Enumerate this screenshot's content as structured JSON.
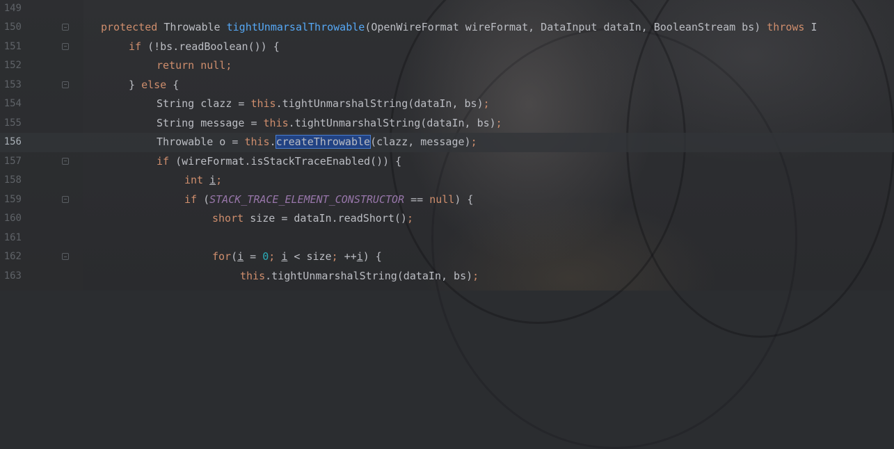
{
  "editor": {
    "current_line": "156",
    "lines": [
      {
        "num": "149",
        "tokens": []
      },
      {
        "num": "150",
        "tokens": [
          {
            "t": "protected ",
            "c": "kw"
          },
          {
            "t": "Throwable ",
            "c": "d"
          },
          {
            "t": "tightUnmarsalThrowable",
            "c": "fn"
          },
          {
            "t": "(OpenWireFormat wireFormat, DataInput dataIn, BooleanStream bs) ",
            "c": "d"
          },
          {
            "t": "throws ",
            "c": "kw"
          },
          {
            "t": "I",
            "c": "d"
          }
        ]
      },
      {
        "num": "151",
        "tokens": [
          {
            "t": "if ",
            "c": "kw"
          },
          {
            "t": "(!bs.readBoolean()) {",
            "c": "d"
          }
        ]
      },
      {
        "num": "152",
        "tokens": [
          {
            "t": "return null",
            "c": "kw"
          },
          {
            "t": ";",
            "c": "kw"
          }
        ]
      },
      {
        "num": "153",
        "tokens": [
          {
            "t": "} ",
            "c": "d"
          },
          {
            "t": "else ",
            "c": "kw"
          },
          {
            "t": "{",
            "c": "d"
          }
        ]
      },
      {
        "num": "154",
        "tokens": [
          {
            "t": "String clazz = ",
            "c": "d"
          },
          {
            "t": "this",
            "c": "kw"
          },
          {
            "t": ".tightUnmarshalString(dataIn, bs)",
            "c": "d"
          },
          {
            "t": ";",
            "c": "kw"
          }
        ]
      },
      {
        "num": "155",
        "tokens": [
          {
            "t": "String message = ",
            "c": "d"
          },
          {
            "t": "this",
            "c": "kw"
          },
          {
            "t": ".tightUnmarshalString(dataIn, bs)",
            "c": "d"
          },
          {
            "t": ";",
            "c": "kw"
          }
        ]
      },
      {
        "num": "156",
        "tokens": [
          {
            "t": "Throwable o = ",
            "c": "d"
          },
          {
            "t": "this",
            "c": "kw"
          },
          {
            "t": ".",
            "c": "d"
          },
          {
            "t": "createThrowable",
            "c": "sel"
          },
          {
            "t": "(clazz, message)",
            "c": "d"
          },
          {
            "t": ";",
            "c": "kw"
          }
        ]
      },
      {
        "num": "157",
        "tokens": [
          {
            "t": "if ",
            "c": "kw"
          },
          {
            "t": "(wireFormat.isStackTraceEnabled()) {",
            "c": "d"
          }
        ]
      },
      {
        "num": "158",
        "tokens": [
          {
            "t": "int ",
            "c": "kw"
          },
          {
            "t": "i",
            "c": "var"
          },
          {
            "t": ";",
            "c": "kw"
          }
        ]
      },
      {
        "num": "159",
        "tokens": [
          {
            "t": "if ",
            "c": "kw"
          },
          {
            "t": "(",
            "c": "d"
          },
          {
            "t": "STACK_TRACE_ELEMENT_CONSTRUCTOR",
            "c": "const"
          },
          {
            "t": " == ",
            "c": "d"
          },
          {
            "t": "null",
            "c": "kw"
          },
          {
            "t": ") {",
            "c": "d"
          }
        ]
      },
      {
        "num": "160",
        "tokens": [
          {
            "t": "short ",
            "c": "kw"
          },
          {
            "t": "size = dataIn.readShort()",
            "c": "d"
          },
          {
            "t": ";",
            "c": "kw"
          }
        ]
      },
      {
        "num": "161",
        "tokens": []
      },
      {
        "num": "162",
        "tokens": [
          {
            "t": "for",
            "c": "kw"
          },
          {
            "t": "(",
            "c": "d"
          },
          {
            "t": "i",
            "c": "var"
          },
          {
            "t": " = ",
            "c": "d"
          },
          {
            "t": "0",
            "c": "num"
          },
          {
            "t": "; ",
            "c": "kw"
          },
          {
            "t": "i",
            "c": "var"
          },
          {
            "t": " < size",
            "c": "d"
          },
          {
            "t": "; ",
            "c": "kw"
          },
          {
            "t": "++",
            "c": "d"
          },
          {
            "t": "i",
            "c": "var"
          },
          {
            "t": ") {",
            "c": "d"
          }
        ]
      },
      {
        "num": "163",
        "tokens": [
          {
            "t": "this",
            "c": "kw"
          },
          {
            "t": ".tightUnmarshalString(dataIn, bs)",
            "c": "d"
          },
          {
            "t": ";",
            "c": "kw"
          }
        ]
      }
    ]
  }
}
